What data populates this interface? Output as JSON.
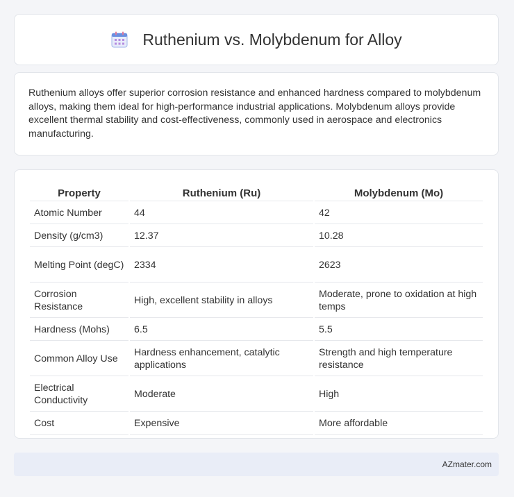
{
  "header": {
    "title": "Ruthenium vs. Molybdenum for Alloy",
    "icon": "calendar-icon"
  },
  "intro": {
    "text": "Ruthenium alloys offer superior corrosion resistance and enhanced hardness compared to molybdenum alloys, making them ideal for high-performance industrial applications. Molybdenum alloys provide excellent thermal stability and cost-effectiveness, commonly used in aerospace and electronics manufacturing."
  },
  "table": {
    "headers": [
      "Property",
      "Ruthenium (Ru)",
      "Molybdenum (Mo)"
    ],
    "rows": [
      [
        "Atomic Number",
        "44",
        "42"
      ],
      [
        "Density (g/cm3)",
        "12.37",
        "10.28"
      ],
      [
        "Melting Point (degC)",
        "2334",
        "2623"
      ],
      [
        "Corrosion Resistance",
        "High, excellent stability in alloys",
        "Moderate, prone to oxidation at high temps"
      ],
      [
        "Hardness (Mohs)",
        "6.5",
        "5.5"
      ],
      [
        "Common Alloy Use",
        "Hardness enhancement, catalytic applications",
        "Strength and high temperature resistance"
      ],
      [
        "Electrical Conductivity",
        "Moderate",
        "High"
      ],
      [
        "Cost",
        "Expensive",
        "More affordable"
      ]
    ]
  },
  "footer": {
    "brand": "AZmater.com"
  },
  "colors": {
    "page_background": "#f4f5f8",
    "card_background": "#ffffff",
    "footer_background": "#e9edf7",
    "icon_accent": "#6b8fe0"
  }
}
